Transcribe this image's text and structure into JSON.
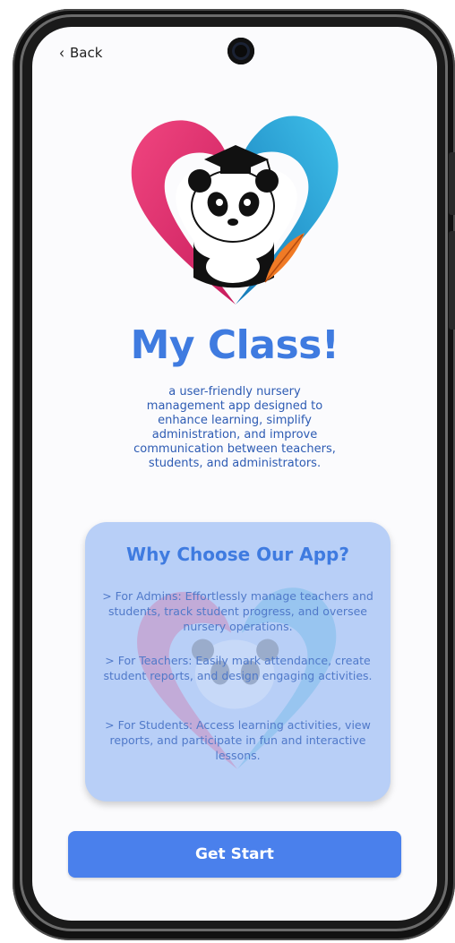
{
  "nav": {
    "back_label": "Back"
  },
  "hero": {
    "title": "My Class!",
    "description": "a user-friendly nursery management app designed to enhance learning, simplify administration, and improve communication between teachers, students, and administrators."
  },
  "card": {
    "title": "Why Choose Our App?",
    "items": [
      "> For Admins: Effortlessly manage teachers and students, track student progress, and oversee nursery operations.",
      "> For Teachers: Easily mark attendance, create student reports, and design engaging activities.",
      "> For Students: Access learning activities, view reports, and participate in fun and interactive lessons."
    ]
  },
  "actions": {
    "start_label": "Get Start"
  },
  "icons": {
    "back": "chevron-left-icon",
    "logo": "panda-heart-logo",
    "camera": "front-camera"
  },
  "colors": {
    "primary": "#4a80ec",
    "title": "#3f7be0",
    "card_bg": "#b8cff7",
    "heart_pink": "#e8306f",
    "heart_blue": "#2aa6d8"
  }
}
